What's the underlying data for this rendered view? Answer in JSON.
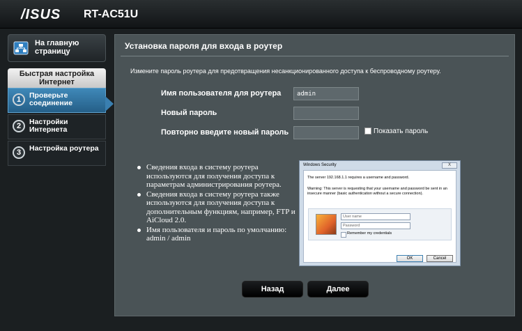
{
  "header": {
    "brand": "/ISUS",
    "model": "RT-AC51U"
  },
  "nav": {
    "home_label": "На главную страницу",
    "quick_setup_title": "Быстрая настройка Интернет",
    "steps": [
      {
        "number": "1",
        "label": "Проверьте соединение",
        "active": true
      },
      {
        "number": "2",
        "label": "Настройки Интернета",
        "active": false
      },
      {
        "number": "3",
        "label": "Настройка роутера",
        "active": false
      }
    ]
  },
  "main": {
    "title": "Установка пароля для входа в роутер",
    "description": "Измените пароль роутера для предотвращения несанкционированного доступа к беспроводному роутеру.",
    "form": {
      "username_label": "Имя пользователя для роутера",
      "username_value": "admin",
      "new_password_label": "Новый пароль",
      "new_password_value": "",
      "confirm_password_label": "Повторно введите новый пароль",
      "confirm_password_value": "",
      "show_password_label": "Показать пароль"
    },
    "notes": [
      "Сведения входа в систему роутера используются для получения доступа к параметрам администрирования роутера.",
      "Сведения входа в систему роутера также используются для получения доступа к дополнительным функциям, например, FTP и AiCloud 2.0.",
      "Имя пользователя и пароль по умолчанию: admin / admin"
    ],
    "dialog": {
      "title": "Windows Security",
      "close": "X",
      "line1": "The server 192.168.1.1 requires a username and password.",
      "line2": "Warning: This server is requesting that your username and password be sent in an insecure manner (basic authentication without a secure connection).",
      "username_placeholder": "User name",
      "password_placeholder": "Password",
      "remember": "Remember my credentials",
      "ok": "OK",
      "cancel": "Cancel"
    },
    "buttons": {
      "back": "Назад",
      "next": "Далее"
    }
  }
}
